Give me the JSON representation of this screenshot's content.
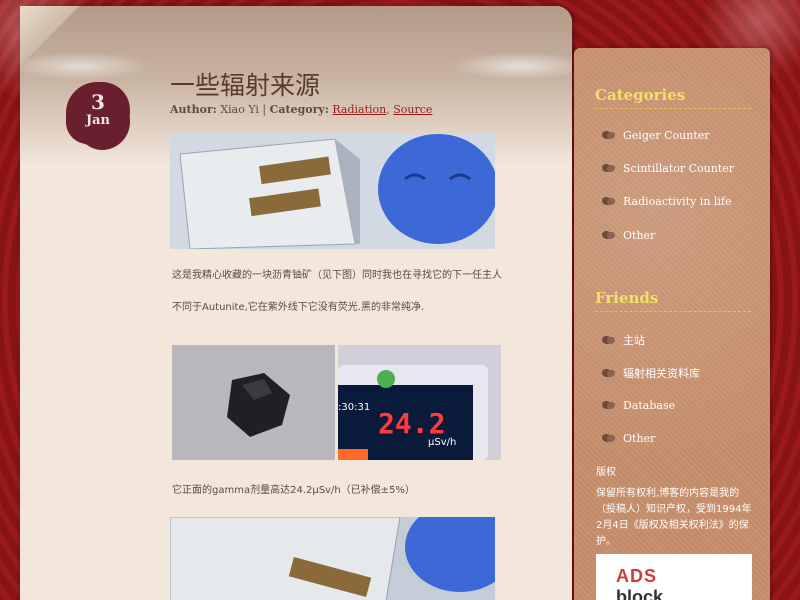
{
  "post": {
    "date_day": "3",
    "date_month": "Jan",
    "title": "一些辐射来源",
    "author_label": "Author:",
    "author": "Xiao Yi",
    "category_label": "Category:",
    "categories": [
      "Radiation",
      "Source"
    ],
    "paragraphs": [
      "这是我精心收藏的一块沥青铀矿（见下图）同时我也在寻找它的下一任主人",
      "不同于Autunite,它在紫外线下它没有荧光.黑的非常纯净.",
      "它正面的gamma剂量高达24.2μSv/h（已补偿±5%）"
    ],
    "geiger_readout": {
      "time": ":30:31",
      "value": "24.2",
      "unit": "μSv/h"
    }
  },
  "sidebar": {
    "categories_heading": "Categories",
    "categories": [
      {
        "label": "Geiger Counter"
      },
      {
        "label": "Scintillator Counter"
      },
      {
        "label": "Radioactivity in life"
      },
      {
        "label": "Other"
      }
    ],
    "friends_heading": "Friends",
    "friends": [
      {
        "label": "主站"
      },
      {
        "label": "辐射相关资料库"
      },
      {
        "label": "Database"
      },
      {
        "label": "Other"
      }
    ],
    "copyright_heading": "版权",
    "copyright_text": "保留所有权利,博客的内容是我的（投稿人）知识产权，受到1994年2月4日《版权及相关权利法》的保护。",
    "ad_line1": "ADS",
    "ad_line2": "block"
  },
  "colors": {
    "background_red": "#8e1416",
    "paper": "#f3e7dc",
    "sidebar": "#c78f6c",
    "heading_yellow": "#f6e06a",
    "link_red": "#9c1b1b",
    "date_blob": "#6a1f2e"
  }
}
